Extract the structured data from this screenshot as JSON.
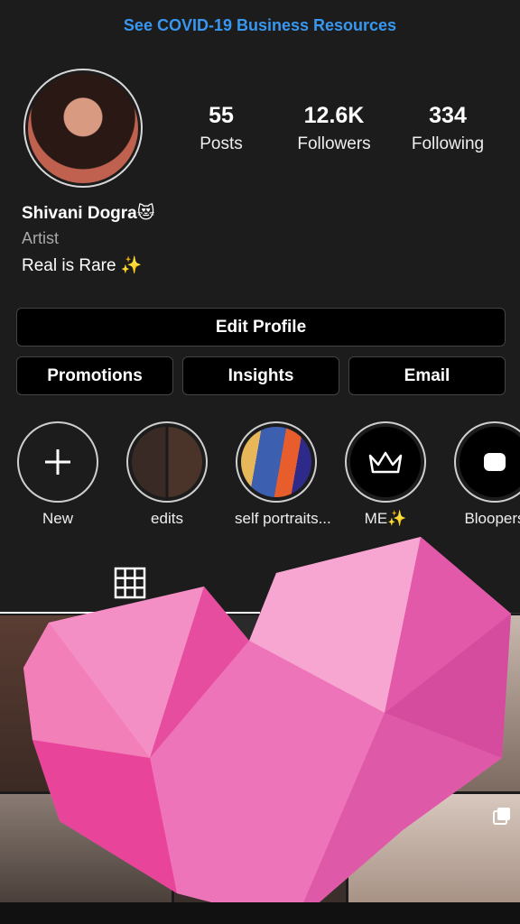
{
  "banner": {
    "link_text": "See COVID-19 Business Resources"
  },
  "profile": {
    "stats": [
      {
        "value": "55",
        "label": "Posts"
      },
      {
        "value": "12.6K",
        "label": "Followers"
      },
      {
        "value": "334",
        "label": "Following"
      }
    ],
    "name": "Shivani Dogra😻",
    "category": "Artist",
    "bio": "Real is Rare ✨"
  },
  "actions": {
    "edit_profile": "Edit Profile",
    "promotions": "Promotions",
    "insights": "Insights",
    "email": "Email"
  },
  "highlights": [
    {
      "label": "New",
      "icon": "plus-icon"
    },
    {
      "label": "edits"
    },
    {
      "label": "self portraits..."
    },
    {
      "label": "ME✨",
      "icon": "crown-icon"
    },
    {
      "label": "Bloopers"
    }
  ],
  "tabs": {
    "active": "grid-icon"
  },
  "colors": {
    "background": "#1c1c1c",
    "link": "#3897f0",
    "heart": "#f06bb4"
  }
}
